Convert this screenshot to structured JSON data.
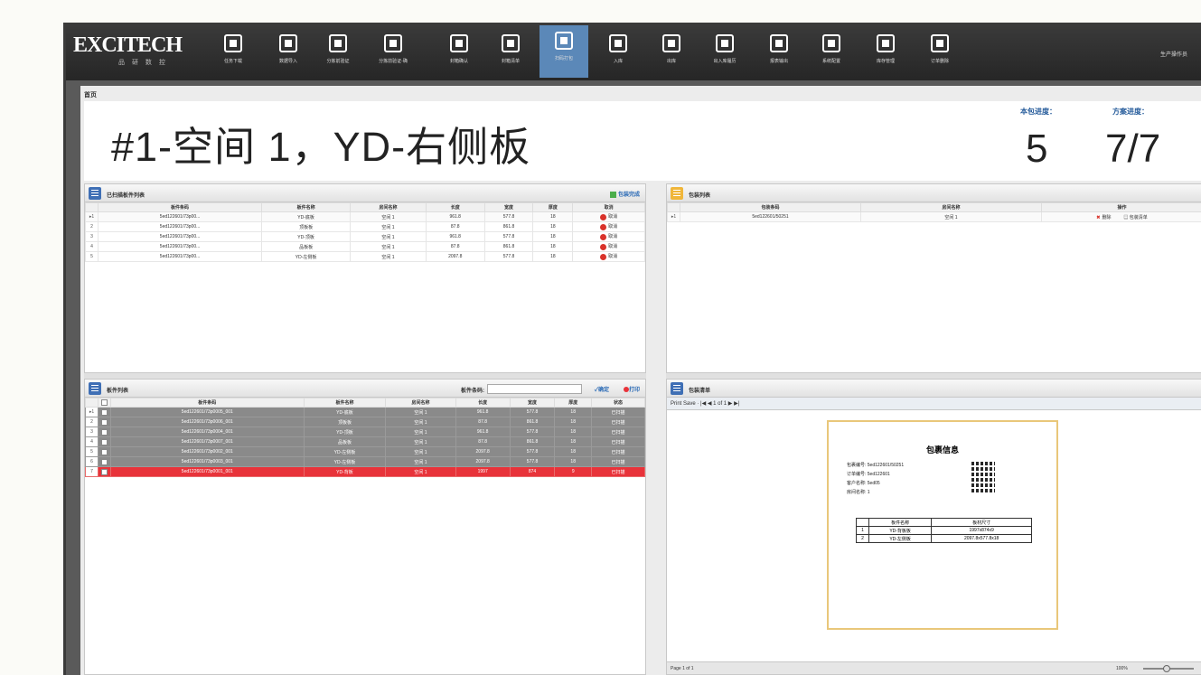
{
  "toolbar": {
    "logo": "EXCITECH",
    "logo_sub": "品 研 数 控",
    "items": [
      {
        "label": "任务下载",
        "icon": "cloud-download-icon"
      },
      {
        "label": "数据导入",
        "icon": "import-icon"
      },
      {
        "label": "分拣前验证",
        "icon": "cart-icon"
      },
      {
        "label": "分拣前验证-确",
        "icon": "cart-icon"
      },
      {
        "label": "封箱确认",
        "icon": "clipboard-icon"
      },
      {
        "label": "封箱清单",
        "icon": "clipboard-icon"
      },
      {
        "label": "扫码打包",
        "icon": "package-icon"
      },
      {
        "label": "入库",
        "icon": "warehouse-in-icon"
      },
      {
        "label": "出库",
        "icon": "warehouse-out-icon"
      },
      {
        "label": "出入库履历",
        "icon": "history-icon"
      },
      {
        "label": "报表输出",
        "icon": "report-icon"
      },
      {
        "label": "系统配置",
        "icon": "settings-icon"
      },
      {
        "label": "库存管理",
        "icon": "inventory-icon"
      },
      {
        "label": "订单删除",
        "icon": "delete-order-icon"
      }
    ],
    "active_index": 6,
    "user": "生产操作员"
  },
  "breadcrumb": "首页",
  "header": {
    "title": "#1-空间 1，YD-右侧板",
    "stat1_label": "本包进度：",
    "stat1_value": "5",
    "stat2_label": "方案进度：",
    "stat2_value": "7/7"
  },
  "scanned_panel": {
    "title": "已扫描板件列表",
    "check_label": "包装完成",
    "columns": [
      "板件条码",
      "板件名称",
      "房间名称",
      "长度",
      "宽度",
      "厚度",
      "取消"
    ],
    "rows": [
      [
        "5ed122601/73p00...",
        "YD-底板",
        "空间 1",
        "961.8",
        "577.8",
        "18",
        "取消"
      ],
      [
        "5ed122601/73p00...",
        "顶板板",
        "空间 1",
        "87.8",
        "861.8",
        "18",
        "取消"
      ],
      [
        "5ed122601/73p00...",
        "YD-顶板",
        "空间 1",
        "961.8",
        "577.8",
        "18",
        "取消"
      ],
      [
        "5ed122601/73p00...",
        "品板板",
        "空间 1",
        "87.8",
        "861.8",
        "18",
        "取消"
      ],
      [
        "5ed122601/73p00...",
        "YD-左侧板",
        "空间 1",
        "2097.8",
        "577.8",
        "18",
        "取消"
      ]
    ]
  },
  "package_panel": {
    "title": "包装列表",
    "columns": [
      "包装条码",
      "房间名称",
      "操作"
    ],
    "rows": [
      {
        "code": "5ed122601/50251",
        "room": "空间 1",
        "delete": "删除",
        "print": "包装清单"
      }
    ]
  },
  "parts_panel": {
    "title": "板件列表",
    "search_label": "板件条码:",
    "confirm": "确定",
    "print": "打印",
    "columns": [
      "板件条码",
      "板件名称",
      "房间名称",
      "长度",
      "宽度",
      "厚度",
      "状态"
    ],
    "rows": [
      [
        "5ed122601/73p0005_001",
        "YD-底板",
        "空间 1",
        "961.8",
        "577.8",
        "18",
        "已扫描"
      ],
      [
        "5ed122601/73p0006_001",
        "顶板板",
        "空间 1",
        "87.8",
        "861.8",
        "18",
        "已扫描"
      ],
      [
        "5ed122601/73p0004_001",
        "YD-顶板",
        "空间 1",
        "961.8",
        "577.8",
        "18",
        "已扫描"
      ],
      [
        "5ed122601/73p0007_001",
        "品板板",
        "空间 1",
        "87.8",
        "861.8",
        "18",
        "已扫描"
      ],
      [
        "5ed122601/73p0002_001",
        "YD-左侧板",
        "空间 1",
        "2097.8",
        "577.8",
        "18",
        "已扫描"
      ],
      [
        "5ed122601/73p0003_001",
        "YD-左侧板",
        "空间 1",
        "2097.8",
        "577.8",
        "18",
        "已扫描"
      ],
      [
        "5ed122601/73p0001_001",
        "YD-背板",
        "空间 1",
        "1997",
        "874",
        "9",
        "已扫描"
      ]
    ]
  },
  "report_panel": {
    "title": "包装清单",
    "toolbar": "Print   Save  ·  |◀ ◀   1 of 1   ▶ ▶|",
    "card_title": "包裹信息",
    "card_rows": [
      "包裹编号: 5ed122601/50251",
      "订单编号: 5ed122601",
      "客户名称: 5ed05",
      "房间名称: 1"
    ],
    "table_header": [
      "",
      "板件名称",
      "板材尺寸"
    ],
    "table_rows": [
      [
        "1",
        "YD-背板板",
        "1997x874x9"
      ],
      [
        "2",
        "YD-左侧板",
        "2097.8x577.8x18"
      ]
    ],
    "status": "Page 1 of 1",
    "zoom": "100%"
  }
}
